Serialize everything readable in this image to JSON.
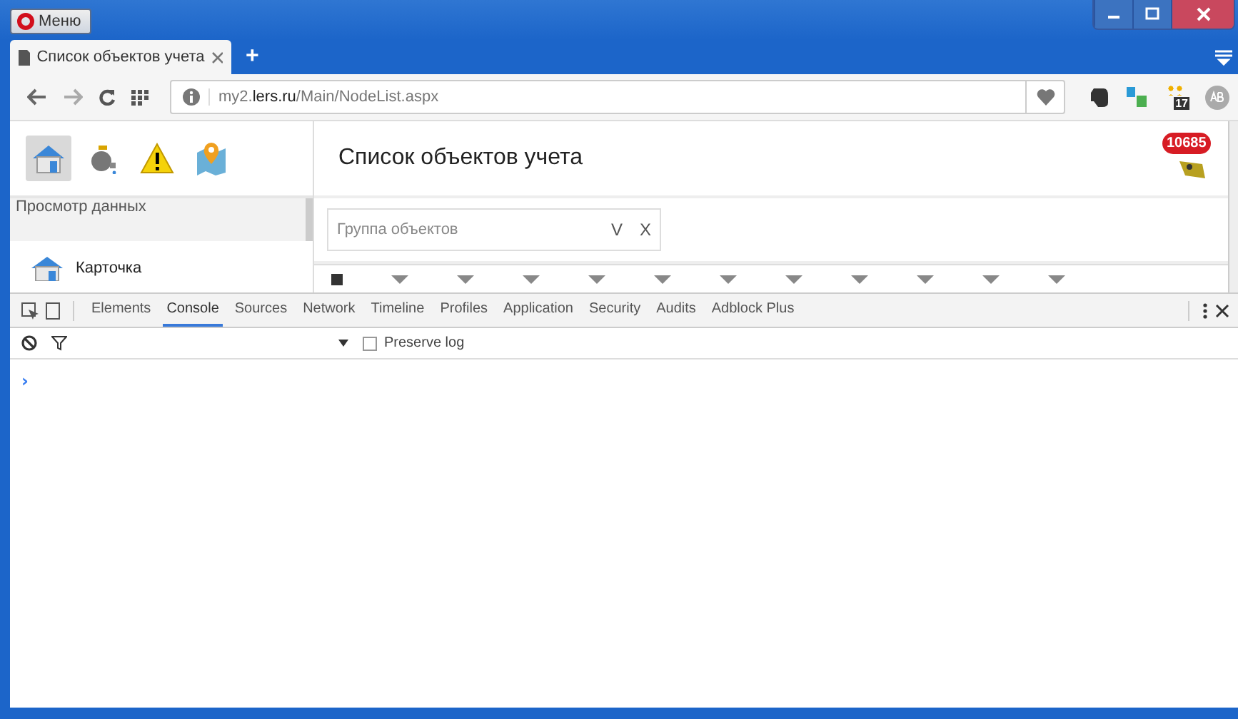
{
  "window": {
    "menu_button": "Меню"
  },
  "tabs": [
    {
      "title": "Список объектов учета",
      "selected": true
    }
  ],
  "new_tab": "+",
  "address": {
    "segments": [
      {
        "text": "my2.",
        "emphasis": false
      },
      {
        "text": "lers.ru",
        "emphasis": true
      },
      {
        "text": "/Main/NodeList.aspx",
        "emphasis": false
      }
    ]
  },
  "extensions": {
    "calendar_badge": "17"
  },
  "page": {
    "toolbar": [
      {
        "kind": "home",
        "selected": true
      },
      {
        "kind": "tap",
        "selected": false
      },
      {
        "kind": "warning",
        "selected": false
      },
      {
        "kind": "map",
        "selected": false
      }
    ],
    "title": "Список объектов учета",
    "notification_count": "10685",
    "sidebar": {
      "heading": "Просмотр данных",
      "items": [
        {
          "label": "Карточка"
        }
      ]
    },
    "table": {
      "select_all": {
        "checked": true
      }
    },
    "group_filter": {
      "placeholder": "Группа объектов",
      "buttons": [
        "V",
        "X"
      ]
    }
  },
  "devtools": {
    "tabs": [
      {
        "label": "Elements",
        "selected": false
      },
      {
        "label": "Console",
        "selected": true
      },
      {
        "label": "Sources",
        "selected": false
      },
      {
        "label": "Network",
        "selected": false
      },
      {
        "label": "Timeline",
        "selected": false
      },
      {
        "label": "Profiles",
        "selected": false
      },
      {
        "label": "Application",
        "selected": false
      },
      {
        "label": "Security",
        "selected": false
      },
      {
        "label": "Audits",
        "selected": false
      },
      {
        "label": "Adblock Plus",
        "selected": false
      }
    ],
    "preserve_log": {
      "label": "Preserve log",
      "checked": false
    },
    "prompt": "›"
  }
}
